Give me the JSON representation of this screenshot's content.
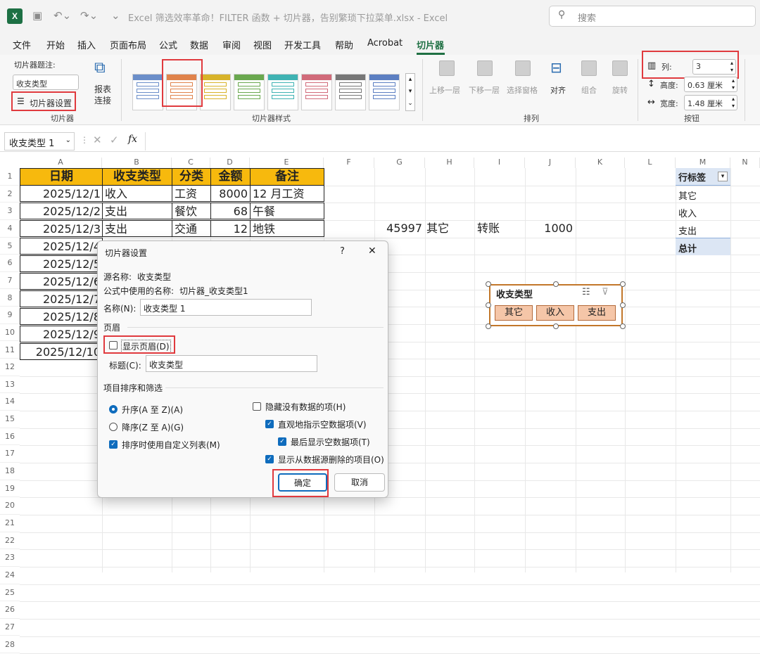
{
  "titlebar": {
    "title": "Excel 筛选效率革命！FILTER 函数 + 切片器，告别繁琐下拉菜单.xlsx  -  Excel",
    "logo": "X",
    "search_placeholder": "搜索",
    "accent": "#1f7043"
  },
  "menu": [
    "文件",
    "开始",
    "插入",
    "页面布局",
    "公式",
    "数据",
    "审阅",
    "视图",
    "开发工具",
    "帮助",
    "Acrobat",
    "切片器"
  ],
  "ribbon": {
    "slicer_group": {
      "caption_label": "切片器题注:",
      "caption_value": "收支类型",
      "settings_button": "切片器设置",
      "report_conn_line1": "报表",
      "report_conn_line2": "连接",
      "group_label": "切片器"
    },
    "styles_group": {
      "group_label": "切片器样式"
    },
    "arrange_group": {
      "bring_forward": "上移一层",
      "send_backward": "下移一层",
      "selection_pane": "选择窗格",
      "align": "对齐",
      "group": "组合",
      "rotate": "旋转",
      "group_label": "排列"
    },
    "buttons_group": {
      "columns_label": "列:",
      "columns_value": "3",
      "height_label": "高度:",
      "height_value": "0.63 厘米",
      "width_label": "宽度:",
      "width_value": "1.48 厘米",
      "group_label": "按钮"
    }
  },
  "formula_bar": {
    "name_box": "收支类型 1",
    "fx": "fx"
  },
  "sheet": {
    "col_headers": [
      "A",
      "B",
      "C",
      "D",
      "E",
      "F",
      "G",
      "H",
      "I",
      "J",
      "K",
      "L",
      "M",
      "N"
    ],
    "row_numbers": [
      "1",
      "2",
      "3",
      "4",
      "5",
      "6",
      "7",
      "8",
      "9",
      "10",
      "11",
      "12",
      "13",
      "14",
      "15",
      "16",
      "17",
      "18",
      "19",
      "20",
      "21",
      "22",
      "23",
      "24",
      "25",
      "26",
      "27",
      "28"
    ],
    "table_headers": [
      "日期",
      "收支类型",
      "分类",
      "金额",
      "备注"
    ],
    "rows": [
      [
        "2025/12/1",
        "收入",
        "工资",
        "8000",
        "12 月工资"
      ],
      [
        "2025/12/2",
        "支出",
        "餐饮",
        "68",
        "午餐"
      ],
      [
        "2025/12/3",
        "支出",
        "交通",
        "12",
        "地铁"
      ],
      [
        "2025/12/4"
      ],
      [
        "2025/12/5"
      ],
      [
        "2025/12/6"
      ],
      [
        "2025/12/7"
      ],
      [
        "2025/12/8"
      ],
      [
        "2025/12/9"
      ],
      [
        "2025/12/10"
      ]
    ],
    "filter_row": {
      "g": "45997",
      "h": "其它",
      "i": "转账",
      "j": "1000"
    },
    "pivot": {
      "header": "行标签",
      "items": [
        "其它",
        "收入",
        "支出"
      ],
      "total": "总计"
    }
  },
  "slicer": {
    "title": "收支类型",
    "items": [
      "其它",
      "收入",
      "支出"
    ]
  },
  "dialog": {
    "title": "切片器设置",
    "help": "?",
    "close": "✕",
    "source_name_label": "源名称:",
    "source_name_value": "收支类型",
    "formula_name_label": "公式中使用的名称:",
    "formula_name_value": "切片器_收支类型1",
    "name_label": "名称(N):",
    "name_value": "收支类型 1",
    "header_section": "页眉",
    "show_header": "显示页眉(D)",
    "caption_label": "标题(C):",
    "caption_value": "收支类型",
    "sort_section": "项目排序和筛选",
    "ascending": "升序(A 至 Z)(A)",
    "descending": "降序(Z 至 A)(G)",
    "custom_list": "排序时使用自定义列表(M)",
    "hide_no_data": "隐藏没有数据的项(H)",
    "indicate_empty": "直观地指示空数据项(V)",
    "show_empty_last": "最后显示空数据项(T)",
    "show_deleted": "显示从数据源删除的项目(O)",
    "ok": "确定",
    "cancel": "取消"
  }
}
